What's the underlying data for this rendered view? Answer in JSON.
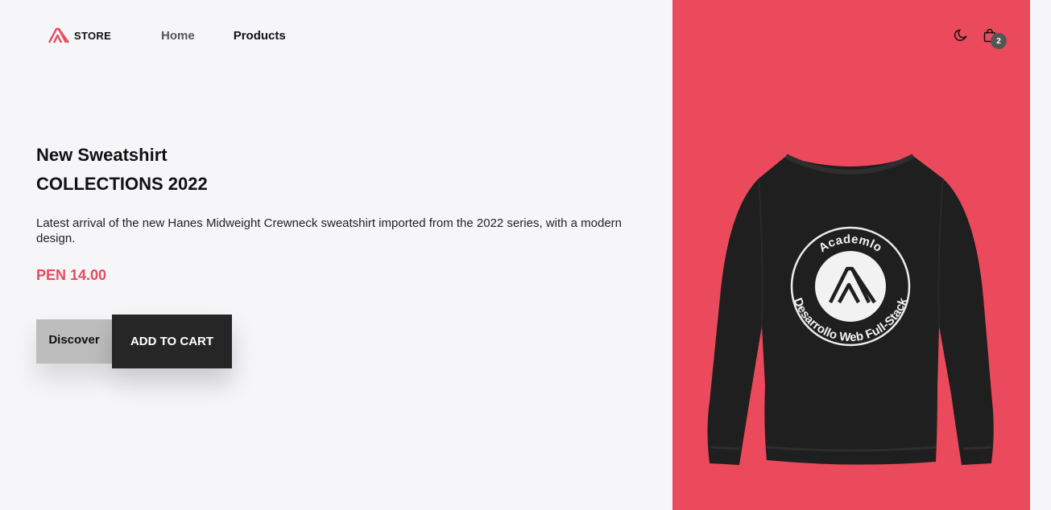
{
  "header": {
    "logo_text": "STORE",
    "nav": [
      {
        "label": "Home"
      },
      {
        "label": "Products"
      }
    ],
    "cart_count": "2",
    "icons": [
      "logo-icon",
      "moon-icon",
      "shopping-bag-icon"
    ]
  },
  "hero": {
    "title_line1": "New Sweatshirt",
    "title_line2": "COLLECTIONS 2022",
    "description": "Latest arrival of the new Hanes Midweight Crewneck sweatshirt imported from the 2022 series, with a modern design.",
    "price": "PEN 14.00",
    "discover_label": "Discover",
    "add_to_cart_label": "ADD TO CART"
  },
  "product_image": {
    "badge_top_text": "Academlo",
    "badge_bottom_text": "Desarrollo Web Full-Stack"
  },
  "colors": {
    "accent": "#ea4a5c",
    "dark_button": "#262626",
    "light_button": "#bdbdbd",
    "background": "#f6f6f9"
  }
}
